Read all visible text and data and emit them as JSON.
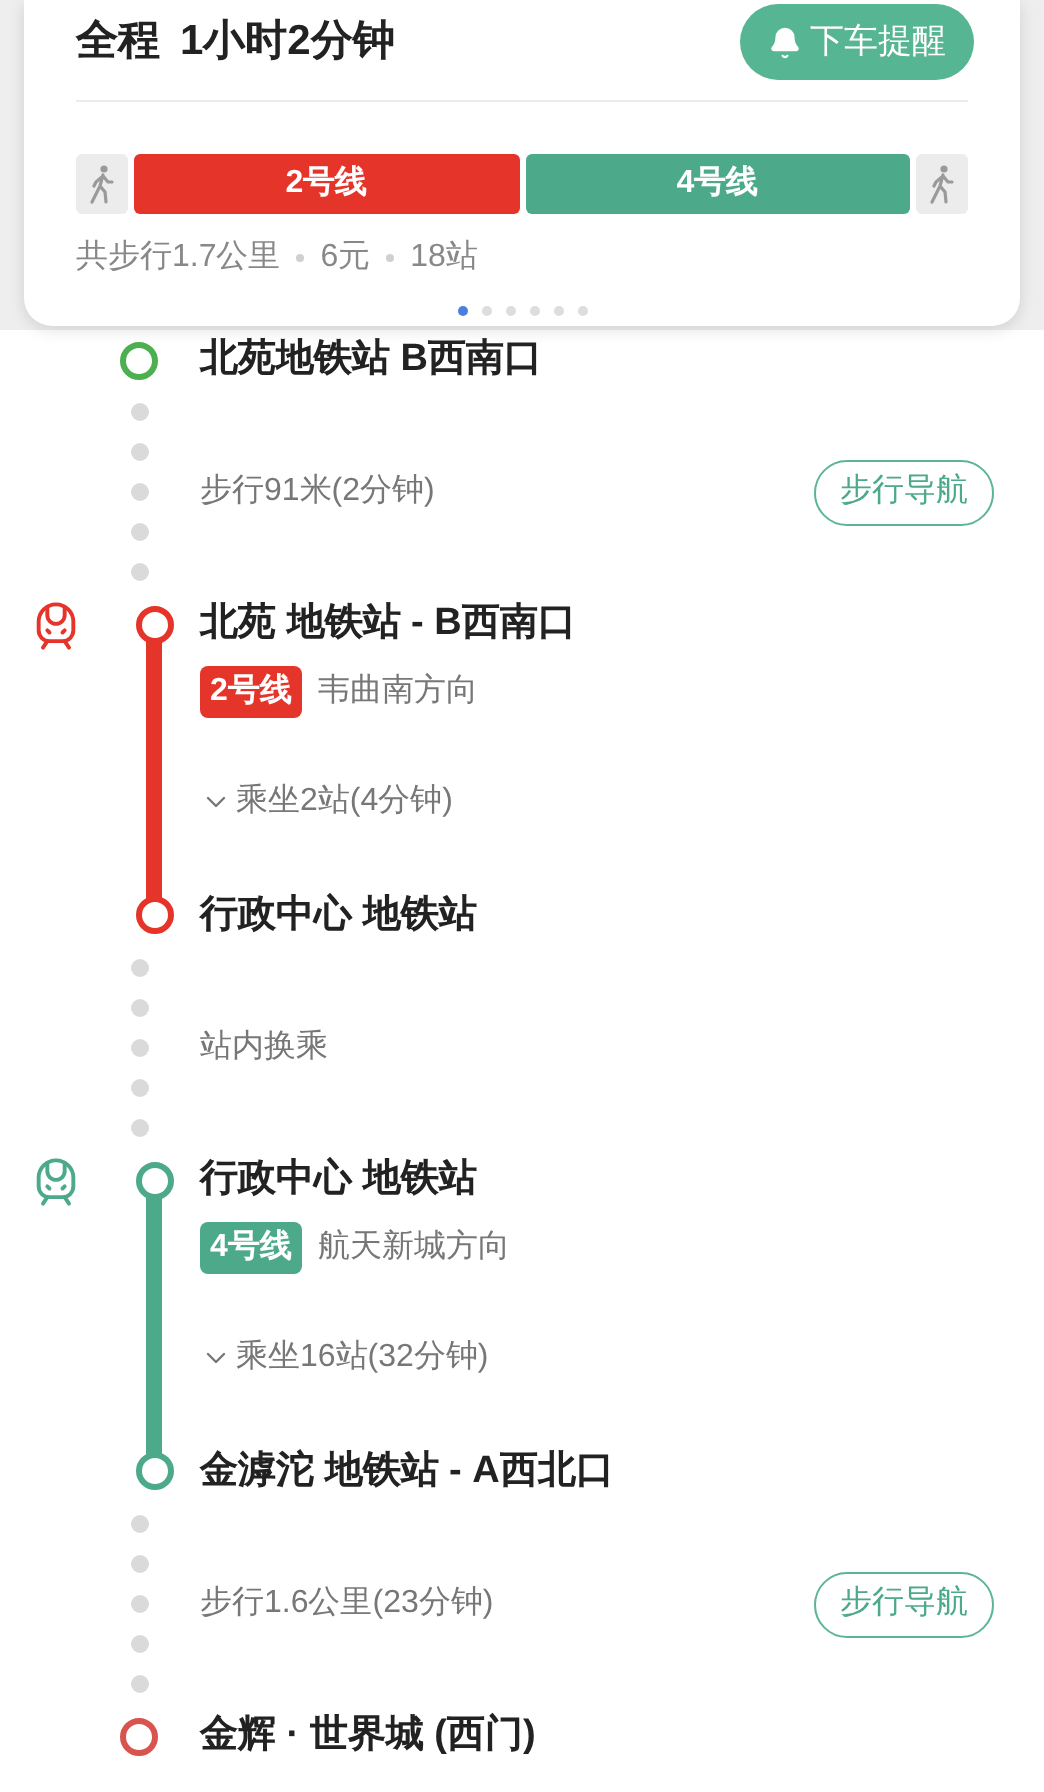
{
  "summary_card": {
    "title": "全程",
    "duration": "1小时2分钟",
    "alert_button": "下车提醒",
    "segments": [
      {
        "kind": "walk"
      },
      {
        "kind": "line",
        "label": "2号线",
        "color": "#e5352b"
      },
      {
        "kind": "line",
        "label": "4号线",
        "color": "#4caa8a"
      },
      {
        "kind": "walk"
      }
    ],
    "facts": [
      "共步行1.7公里",
      "6元",
      "18站"
    ],
    "pages": [
      {
        "selected": true
      },
      {
        "selected": false
      },
      {
        "selected": false
      },
      {
        "selected": false
      },
      {
        "selected": false
      },
      {
        "selected": false
      }
    ]
  },
  "steps": [
    {
      "kind": "station",
      "name": "北苑地铁站 B西南口",
      "color": "#4caf50"
    },
    {
      "kind": "walk",
      "text": "步行91米(2分钟)",
      "nav_button": "步行导航"
    },
    {
      "kind": "transit",
      "color": "#e5352b",
      "start": "北苑 地铁站 - B西南口",
      "line": "2号线",
      "direction": "韦曲南方向",
      "ride": "乘坐2站(4分钟)",
      "end": "行政中心 地铁站"
    },
    {
      "kind": "walk",
      "text": "站内换乘"
    },
    {
      "kind": "transit",
      "color": "#4caa8a",
      "start": "行政中心 地铁站",
      "line": "4号线",
      "direction": "航天新城方向",
      "ride": "乘坐16站(32分钟)",
      "end": "金滹沱 地铁站 - A西北口"
    },
    {
      "kind": "walk",
      "text": "步行1.6公里(23分钟)",
      "nav_button": "步行导航"
    },
    {
      "kind": "station",
      "name": "金辉 · 世界城 (西门)",
      "color": "#d9534f"
    }
  ]
}
